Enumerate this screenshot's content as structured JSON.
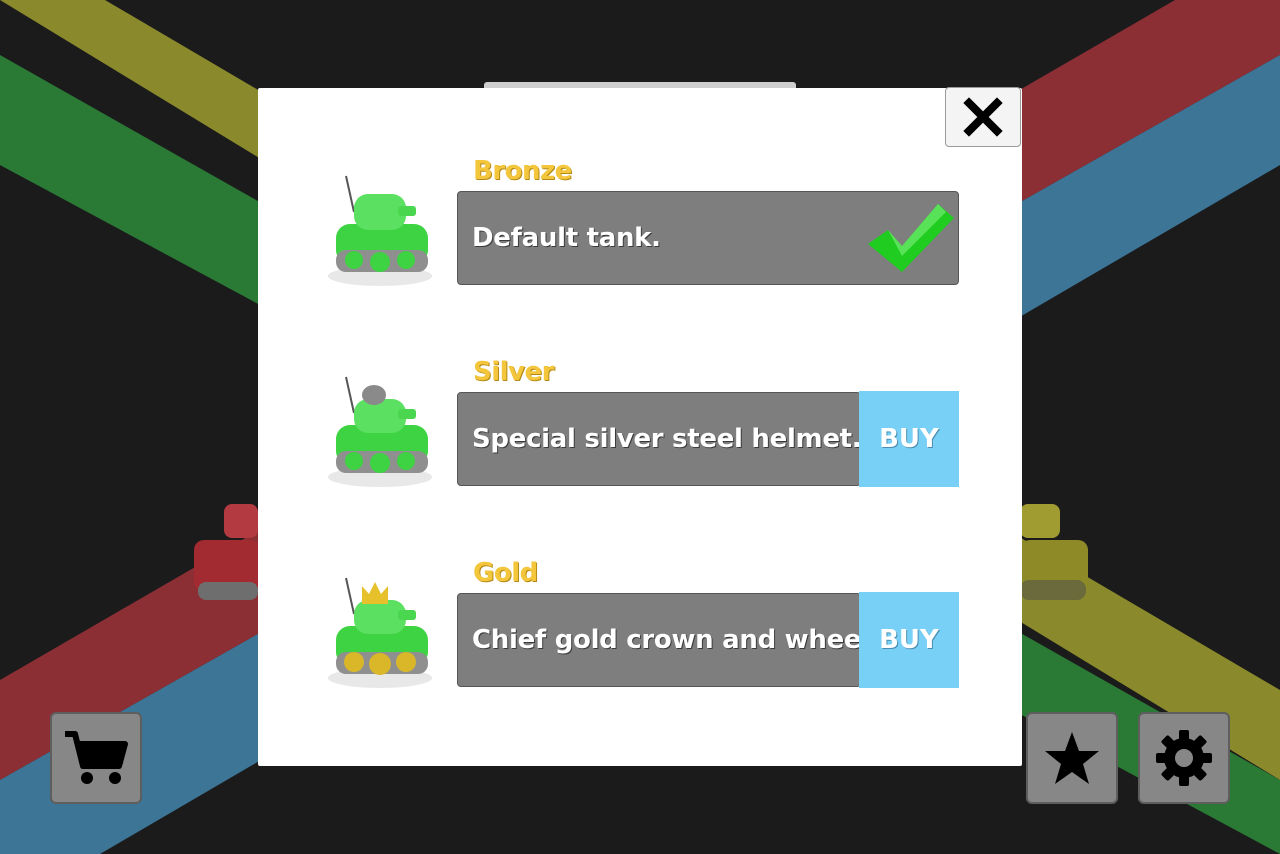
{
  "colors": {
    "background": "#1c1b1c",
    "stripe_yellow": "#8a8a2c",
    "stripe_green": "#2a7a35",
    "stripe_red": "#8b2f35",
    "stripe_blue": "#3c7596",
    "title_gold": "#f3c63c",
    "bar_grey": "#7f7e7e",
    "buy_blue": "#79d0f7",
    "check_green": "#1fcc1f"
  },
  "dialog": {
    "close_icon": "close-x-icon",
    "tiers": [
      {
        "title": "Bronze",
        "description": "Default tank.",
        "owned_icon": "checkmark-icon",
        "tank_icon": "green-tank-icon"
      },
      {
        "title": "Silver",
        "description": "Special silver steel helmet.",
        "buy_label": "BUY",
        "tank_icon": "green-tank-helmet-icon"
      },
      {
        "title": "Gold",
        "description": "Chief gold crown and wheels.",
        "buy_label": "BUY",
        "tank_icon": "green-tank-crown-icon"
      }
    ]
  },
  "toolbar": {
    "shop_icon": "shopping-cart-icon",
    "favorites_icon": "star-icon",
    "settings_icon": "gear-icon"
  }
}
